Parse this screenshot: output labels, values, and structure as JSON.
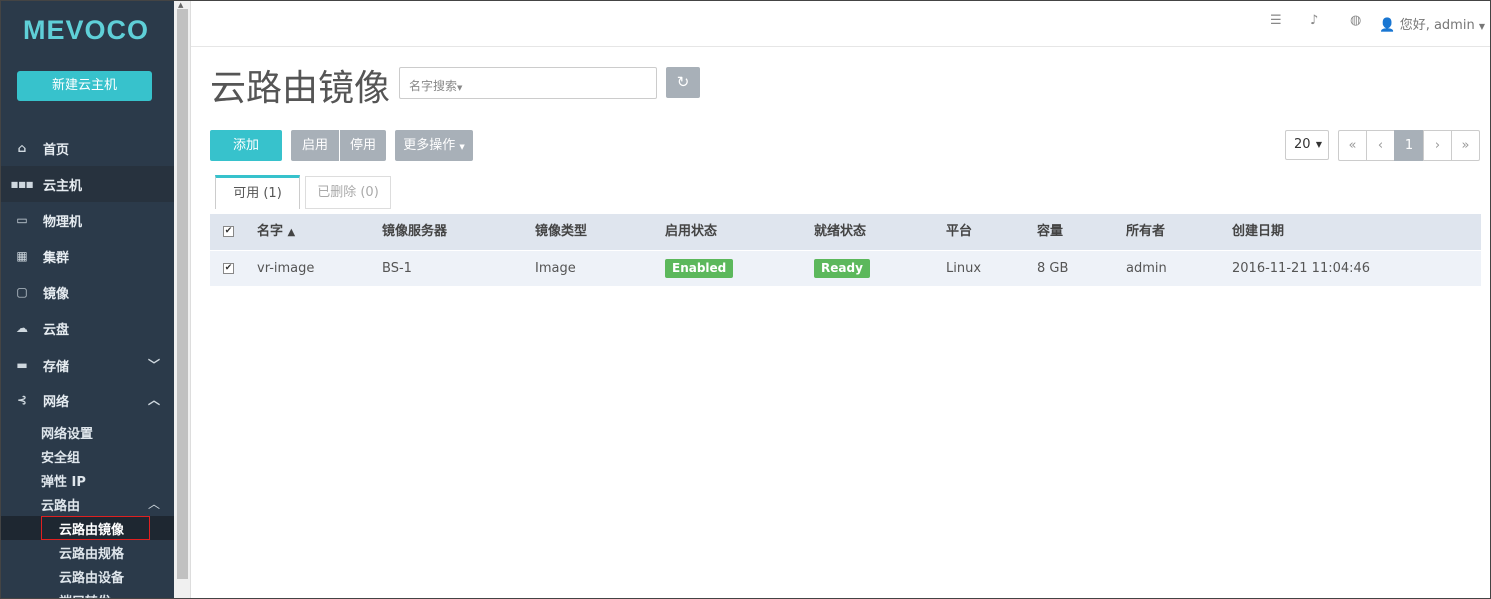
{
  "sidebar": {
    "logo": "MEVOCO",
    "new_vm_label": "新建云主机",
    "items": [
      {
        "label": "首页",
        "icon": "home-icon",
        "glyph": "⌂"
      },
      {
        "label": "云主机",
        "icon": "grid-icon",
        "glyph": "▪▪▪"
      },
      {
        "label": "物理机",
        "icon": "monitor-icon",
        "glyph": "▭"
      },
      {
        "label": "集群",
        "icon": "cluster-icon",
        "glyph": "▦"
      },
      {
        "label": "镜像",
        "icon": "image-icon",
        "glyph": "▢"
      },
      {
        "label": "云盘",
        "icon": "cloud-icon",
        "glyph": "☁"
      },
      {
        "label": "存储",
        "icon": "storage-icon",
        "glyph": "▬"
      },
      {
        "label": "网络",
        "icon": "network-icon",
        "glyph": "⊰"
      }
    ],
    "network_sub": [
      "网络设置",
      "安全组",
      "弹性 IP",
      "云路由"
    ],
    "router_sub": [
      "云路由镜像",
      "云路由规格",
      "云路由设备",
      "端口转发"
    ]
  },
  "topbar": {
    "user_greeting": "您好, admin"
  },
  "page": {
    "title": "云路由镜像",
    "search_placeholder": "名字搜索"
  },
  "actions": {
    "add": "添加",
    "enable": "启用",
    "disable": "停用",
    "more": "更多操作"
  },
  "pagination": {
    "page_size": "20",
    "first": "«",
    "prev": "‹",
    "current": "1",
    "next": "›",
    "last": "»"
  },
  "tabs": {
    "available": "可用 (1)",
    "deleted": "已删除 (0)"
  },
  "table": {
    "columns": [
      "名字",
      "镜像服务器",
      "镜像类型",
      "启用状态",
      "就绪状态",
      "平台",
      "容量",
      "所有者",
      "创建日期"
    ],
    "rows": [
      {
        "name": "vr-image",
        "backup_storage": "BS-1",
        "type": "Image",
        "state": "Enabled",
        "status": "Ready",
        "platform": "Linux",
        "size": "8 GB",
        "owner": "admin",
        "created": "2016-11-21 11:04:46"
      }
    ]
  },
  "colors": {
    "accent": "#37c2cc",
    "sidebar_bg": "#2b3a4a",
    "badge_green": "#5cb85c"
  }
}
